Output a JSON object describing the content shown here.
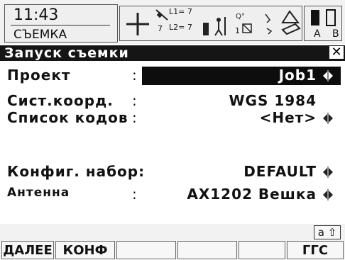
{
  "status": {
    "time": "11:43",
    "mode": "СЪЕМКА",
    "l1_sats": "L1= 7",
    "l2_sats": "L2= 7",
    "sat_count": "7",
    "memory_text": "1",
    "battery_letters": "A B"
  },
  "dialog": {
    "title": "Запуск съемки",
    "close_symbol": "✕",
    "rows": [
      {
        "label": "Проект",
        "colon": ":",
        "value": "Job1",
        "has_selector": true
      },
      {
        "label": "Сист.коорд.",
        "colon": ":",
        "value": "WGS 1984",
        "has_selector": false
      },
      {
        "label": "Список кодов",
        "colon": ":",
        "value": "<Нет>",
        "has_selector": true
      },
      {
        "label": "Конфиг. набор:",
        "colon": "",
        "value": "DEFAULT",
        "has_selector": true
      },
      {
        "label": "Антенна",
        "colon": ":",
        "value": "AX1202 Вешка",
        "has_selector": true
      }
    ]
  },
  "keyboard_indicator": "a ⇧",
  "function_keys": [
    "ДАЛЕЕ",
    "КОНФ",
    "",
    "",
    "",
    "ГГС"
  ],
  "colors": {
    "title_bar": "#151515",
    "highlight": "#0d0d0d",
    "background": "#ffffff"
  },
  "icons": [
    "crosshair-icon",
    "satellite-icon",
    "antenna-icon",
    "memory-icon",
    "battery-icon",
    "selector-arrows-icon",
    "close-icon"
  ]
}
